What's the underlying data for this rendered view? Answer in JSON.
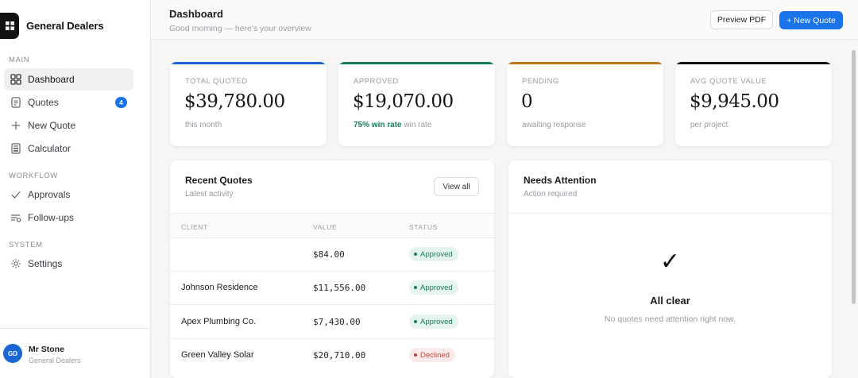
{
  "brand": {
    "name": "General Dealers"
  },
  "sidebar": {
    "sections": [
      {
        "label": "MAIN"
      },
      {
        "label": "WORKFLOW"
      },
      {
        "label": "SYSTEM"
      }
    ],
    "items": [
      {
        "label": "Dashboard",
        "icon": "grid-icon",
        "active": true
      },
      {
        "label": "Quotes",
        "icon": "document-icon",
        "badge": "4"
      },
      {
        "label": "New Quote",
        "icon": "plus-icon"
      },
      {
        "label": "Calculator",
        "icon": "calculator-icon"
      },
      {
        "label": "Approvals",
        "icon": "check-icon"
      },
      {
        "label": "Follow-ups",
        "icon": "follow-up-icon"
      },
      {
        "label": "Settings",
        "icon": "gear-icon"
      }
    ],
    "user": {
      "initials": "GD",
      "name": "Mr Stone",
      "org": "General Dealers"
    }
  },
  "header": {
    "title": "Dashboard",
    "subtitle": "Good morning — here's your overview",
    "preview_label": "Preview PDF",
    "new_quote_label": "+ New Quote"
  },
  "stats": [
    {
      "label": "TOTAL QUOTED",
      "value": "$39,780.00",
      "note": "this month",
      "color": "#1a66d2"
    },
    {
      "label": "APPROVED",
      "value": "$19,070.00",
      "note_accent": "75% win rate",
      "note": "win rate",
      "color": "#177c5c"
    },
    {
      "label": "PENDING",
      "value": "0",
      "note": "awaiting response",
      "color": "#b97814"
    },
    {
      "label": "AVG QUOTE VALUE",
      "value": "$9,945.00",
      "note": "per project",
      "color": "#111111"
    }
  ],
  "recent": {
    "title": "Recent Quotes",
    "subtitle": "Latest activity",
    "view_all": "View all",
    "columns": [
      "CLIENT",
      "VALUE",
      "STATUS"
    ],
    "rows": [
      {
        "client": "",
        "value": "$84.00",
        "status": "Approved"
      },
      {
        "client": "Johnson Residence",
        "value": "$11,556.00",
        "status": "Approved"
      },
      {
        "client": "Apex Plumbing Co.",
        "value": "$7,430.00",
        "status": "Approved"
      },
      {
        "client": "Green Valley Solar",
        "value": "$20,710.00",
        "status": "Declined"
      }
    ]
  },
  "attention": {
    "title": "Needs Attention",
    "subtitle": "Action required",
    "check_glyph": "✓",
    "clear_title": "All clear",
    "clear_sub": "No quotes need attention right now."
  },
  "colors": {
    "accent": "#1a73e8",
    "success": "#177c5c",
    "danger": "#c2463a"
  }
}
